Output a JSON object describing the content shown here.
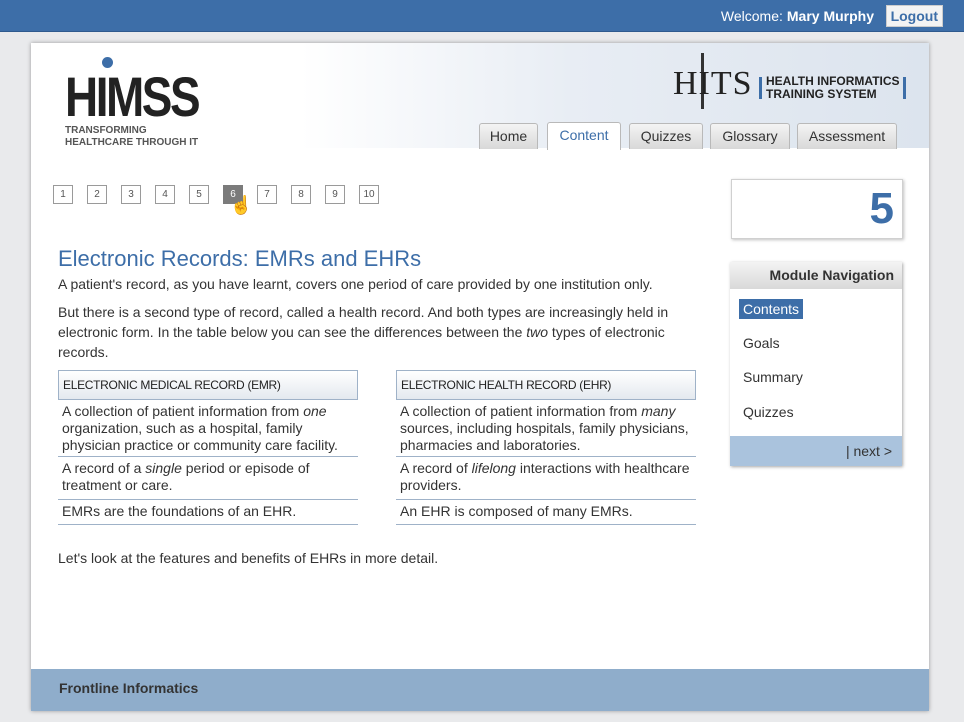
{
  "topbar": {
    "welcome_label": "Welcome:",
    "user_name": "Mary Murphy",
    "logout_label": "Logout"
  },
  "branding": {
    "himss_word": "HIMSS",
    "himss_tagline": "TRANSFORMING HEALTHCARE THROUGH IT",
    "hits_word": "HITS",
    "hits_line1": "HEALTH INFORMATICS",
    "hits_line2": "TRAINING SYSTEM"
  },
  "tabs": [
    {
      "label": "Home"
    },
    {
      "label": "Content",
      "active": true
    },
    {
      "label": "Quizzes"
    },
    {
      "label": "Glossary"
    },
    {
      "label": "Assessment"
    }
  ],
  "pager": {
    "pages": [
      "1",
      "2",
      "3",
      "4",
      "5",
      "6",
      "7",
      "8",
      "9",
      "10"
    ],
    "current": "6"
  },
  "content": {
    "title": "Electronic Records: EMRs and EHRs",
    "para1": "A patient's record, as you have learnt, covers one period of care provided by one institution only.",
    "para2a": "But there is a second type of record, called a health record. And both types are increasingly held in electronic form. In the table below you can see the differences between the ",
    "para2_em": "two",
    "para2b": " types of electronic records.",
    "para4": "Let's look at the features and benefits of EHRs in more detail."
  },
  "table": {
    "emr": {
      "header": "ELECTRONIC MEDICAL RECORD (EMR)",
      "row1a": "A collection of patient information from ",
      "row1_em": "one",
      "row1b": " organization, such as a hospital, family physician practice or community care facility.",
      "row2a": "A record of a ",
      "row2_em": "single",
      "row2b": " period or episode of treatment or care.",
      "row3": "EMRs are the foundations of an EHR."
    },
    "ehr": {
      "header": "ELECTRONIC HEALTH RECORD (EHR)",
      "row1a": "A collection of patient information from ",
      "row1_em": "many",
      "row1b": " sources, including hospitals, family physicians, pharmacies and laboratories.",
      "row2a": "A record of ",
      "row2_em": "lifelong",
      "row2b": " interactions with healthcare providers.",
      "row3": "An EHR is composed of many EMRs."
    }
  },
  "counter": {
    "value": "5"
  },
  "module_nav": {
    "title": "Module Navigation",
    "items": [
      "Contents",
      "Goals",
      "Summary",
      "Quizzes"
    ],
    "next_label": "| next >"
  },
  "footer": {
    "text": "Frontline Informatics"
  },
  "colors": {
    "accent": "#3d6ea8",
    "footer": "#8fadcb",
    "nav_footer": "#aac3dd"
  }
}
